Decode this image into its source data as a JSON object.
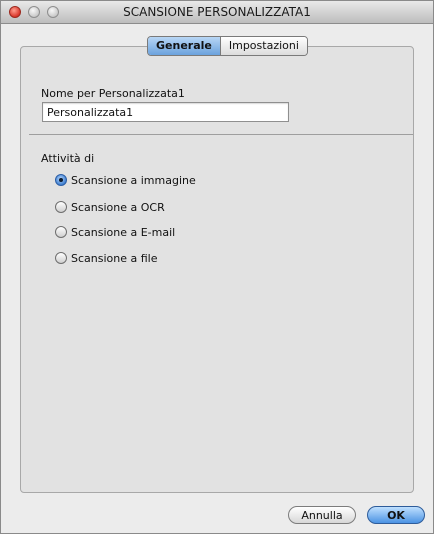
{
  "window": {
    "title": "SCANSIONE PERSONALIZZATA1"
  },
  "tabs": [
    {
      "label": "Generale",
      "active": true
    },
    {
      "label": "Impostazioni",
      "active": false
    }
  ],
  "name_section": {
    "label": "Nome per Personalizzata1",
    "value": "Personalizzata1"
  },
  "activity_section": {
    "label": "Attività di",
    "options": [
      {
        "label": "Scansione a immagine",
        "checked": true
      },
      {
        "label": "Scansione a OCR",
        "checked": false
      },
      {
        "label": "Scansione a E-mail",
        "checked": false
      },
      {
        "label": "Scansione a file",
        "checked": false
      }
    ]
  },
  "buttons": {
    "cancel_label": "Annulla",
    "ok_label": "OK"
  },
  "colors": {
    "accent": "#6ba2dd",
    "window_bg": "#ececec",
    "close_red": "#d9362a"
  }
}
